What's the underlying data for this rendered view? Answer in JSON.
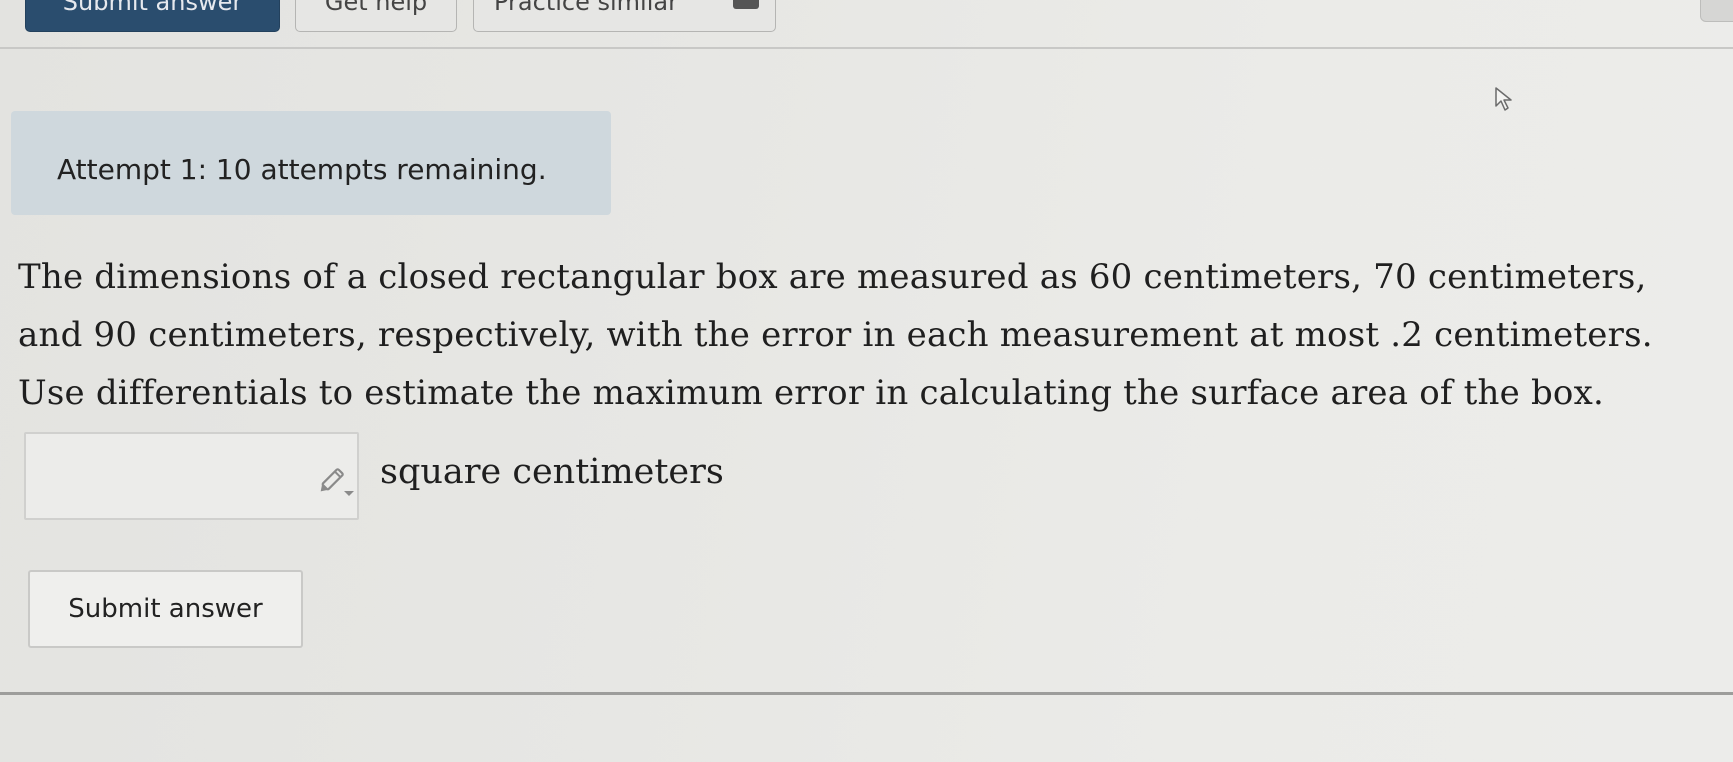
{
  "toolbar": {
    "submit_label": "Submit answer",
    "help_label": "Get help",
    "practice_label": "Practice similar"
  },
  "attempt": {
    "text": "Attempt 1: 10 attempts remaining."
  },
  "question": {
    "text": "The dimensions of a closed rectangular box are measured as 60 centimeters, 70 centimeters, and 90 centimeters, respectively, with the error in each measurement at most .2 centimeters. Use differentials to estimate the maximum error in calculating the surface area of the box."
  },
  "answer": {
    "value": "",
    "unit_label": "square centimeters",
    "tool_icon": "pencil-icon"
  },
  "submit": {
    "label": "Submit answer"
  },
  "colors": {
    "primary_button": "#2a4d6e",
    "banner_bg": "#cfd8dd"
  }
}
